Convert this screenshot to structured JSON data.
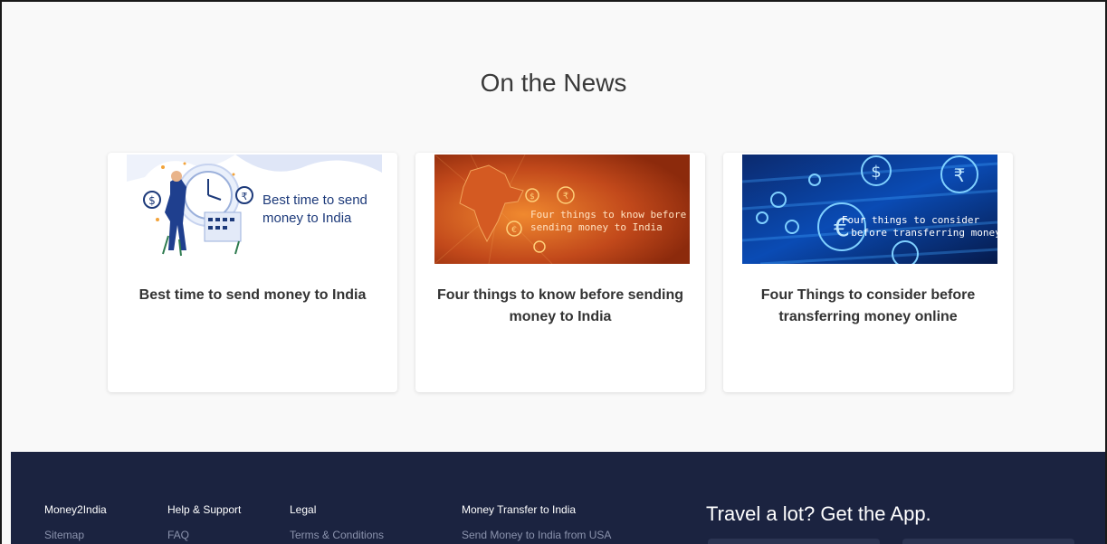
{
  "news": {
    "title": "On the News",
    "cards": [
      {
        "title": "Best time to send money to India",
        "image_text": [
          "Best time to send",
          "money to India"
        ]
      },
      {
        "title": "Four things to know before sending money to India",
        "image_text": [
          "Four things to know before",
          "sending money to India"
        ]
      },
      {
        "title": "Four Things to consider before transferring money online",
        "image_text": [
          "Four things to consider",
          "before transferring money"
        ]
      }
    ]
  },
  "footer": {
    "columns": [
      {
        "heading": "Money2India",
        "link": "Sitemap"
      },
      {
        "heading": "Help & Support",
        "link": "FAQ"
      },
      {
        "heading": "Legal",
        "link": "Terms & Conditions"
      },
      {
        "heading": "Money Transfer to India",
        "link": "Send Money to India from USA"
      }
    ],
    "app_title": "Travel a lot? Get the App."
  },
  "colors": {
    "footer_bg": "#1b2340",
    "section_bg": "#f9f9f9",
    "card2_orange": "#c2491b",
    "card3_blue": "#0a3a8f"
  }
}
